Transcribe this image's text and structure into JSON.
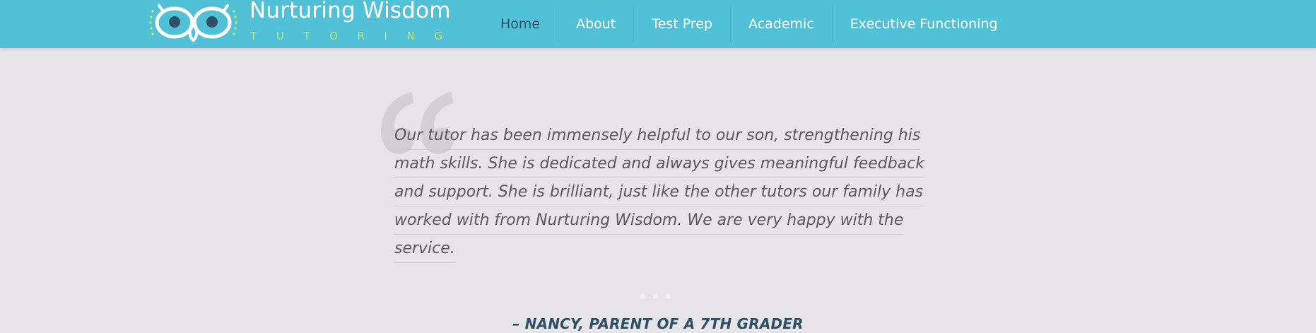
{
  "brand": {
    "name": "Nurturing Wisdom",
    "tagline": "TUTORING",
    "logo_icon": "owl-icon"
  },
  "nav": {
    "items": [
      {
        "label": "Home",
        "active": true
      },
      {
        "label": "About",
        "active": false
      },
      {
        "label": "Test Prep",
        "active": false
      },
      {
        "label": "Academic",
        "active": false
      },
      {
        "label": "Executive Functioning",
        "active": false
      }
    ]
  },
  "testimonial": {
    "quote_icon": "quote-mark-icon",
    "lines": [
      "Our tutor has been immensely helpful to our son, strengthening his",
      "math skills. She is dedicated and always gives meaningful feedback",
      "and support. She is brilliant, just like the other tutors our family has",
      "worked with from Nurturing Wisdom. We are very happy with the",
      "service."
    ],
    "author": "– NANCY, PARENT OF A 7TH GRADER"
  },
  "colors": {
    "header": "#50c1d6",
    "background": "#e6e4e7",
    "tagline": "#c7e36b",
    "accent_dark": "#2f4f66"
  }
}
